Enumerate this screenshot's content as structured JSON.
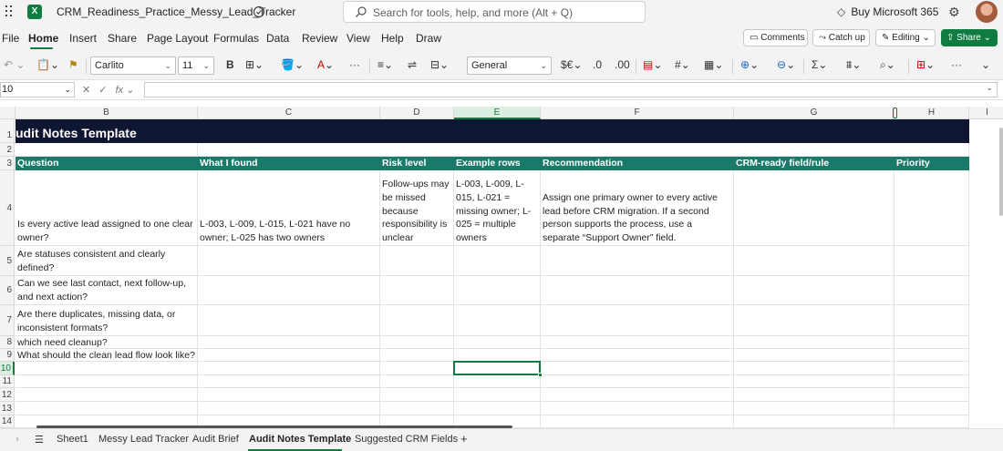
{
  "app": {
    "title": "CRM_Readiness_Practice_Messy_Lead_Tracker",
    "logo_letter": "X",
    "search_placeholder": "Search for tools, help, and more (Alt + Q)",
    "buy_label": "Buy Microsoft 365",
    "accent": "#107c41"
  },
  "menu": {
    "items": [
      "File",
      "Home",
      "Insert",
      "Share",
      "Page Layout",
      "Formulas",
      "Data",
      "Review",
      "View",
      "Help",
      "Draw"
    ],
    "active": "Home",
    "comments_label": "Comments",
    "catchup_label": "Catch up",
    "editing_label": "Editing",
    "share_label": "Share"
  },
  "ribbon": {
    "font_name": "Carlito",
    "font_size": "11",
    "number_format": "General",
    "bold_label": "B",
    "sum_label": "Σ"
  },
  "formula_bar": {
    "name_box": "10",
    "fx_label": "fx",
    "value": ""
  },
  "grid": {
    "columns": [
      "B",
      "C",
      "D",
      "E",
      "F",
      "G",
      "H",
      "I"
    ],
    "selected_column": "E",
    "rows": [
      "1",
      "2",
      "3",
      "4",
      "5",
      "6",
      "7",
      "8",
      "9",
      "10",
      "11",
      "12",
      "13",
      "14"
    ],
    "selected_row": "10",
    "title": "udit Notes Template",
    "header_color": "#1a7a6a",
    "title_color": "#0f1631",
    "headers": [
      "Question",
      "What I found",
      "Risk level",
      "Example rows",
      "Recommendation",
      "CRM-ready field/rule",
      "Priority"
    ],
    "row4": {
      "question": "Is every active lead assigned to one clear owner?",
      "found": "L-003, L-009, L-015, L-021 have no owner; L-025 has two owners",
      "risk": "Follow-ups may be missed because responsibility is unclear",
      "examples": "L-003, L-009, L-015, L-021 = missing owner; L-025 = multiple owners",
      "recommendation": "Assign one primary owner to every active lead before CRM migration. If a second person supports the process, use a separate “Support Owner” field."
    },
    "questions": {
      "r5": "Are statuses consistent and clearly defined?",
      "r6": "Can we see last contact, next follow-up, and next action?",
      "r7": "Are there duplicates, missing data, or inconsistent formats?",
      "r8": "which need cleanup?",
      "r9": "What should the clean lead flow look like?"
    }
  },
  "sheets": {
    "tabs": [
      "Sheet1",
      "Messy Lead Tracker",
      "Audit Brief",
      "Audit Notes Template",
      "Suggested CRM Fields"
    ],
    "active": "Audit Notes Template",
    "add_label": "+"
  }
}
